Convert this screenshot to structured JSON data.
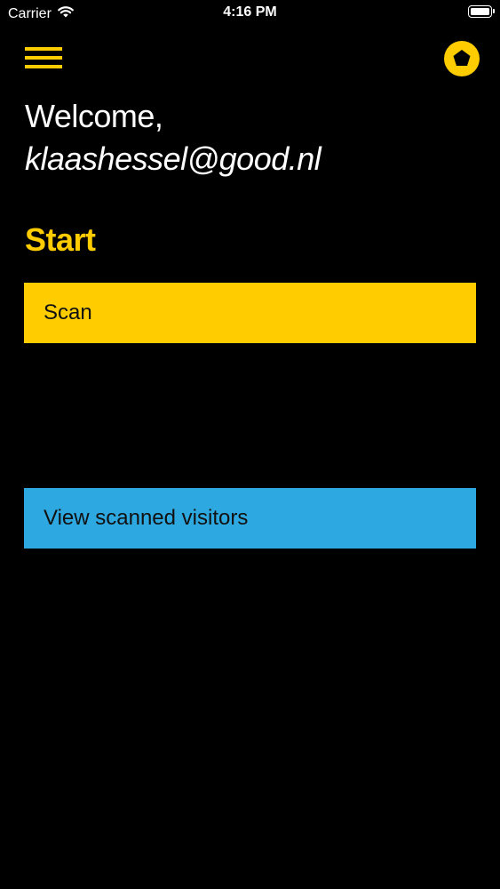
{
  "status_bar": {
    "carrier": "Carrier",
    "time": "4:16 PM"
  },
  "header": {
    "menu_icon": "hamburger-menu-icon",
    "logo_icon": "yellow-ring-logo-icon"
  },
  "welcome": {
    "greeting": "Welcome,",
    "email": "klaashessel@good.nl"
  },
  "section": {
    "title": "Start"
  },
  "actions": {
    "scan_label": "Scan",
    "view_visitors_label": "View scanned visitors"
  },
  "colors": {
    "background": "#000000",
    "accent_yellow": "#ffcc00",
    "accent_blue": "#2ea8e0",
    "text_light": "#ffffff",
    "text_dark": "#111111"
  }
}
